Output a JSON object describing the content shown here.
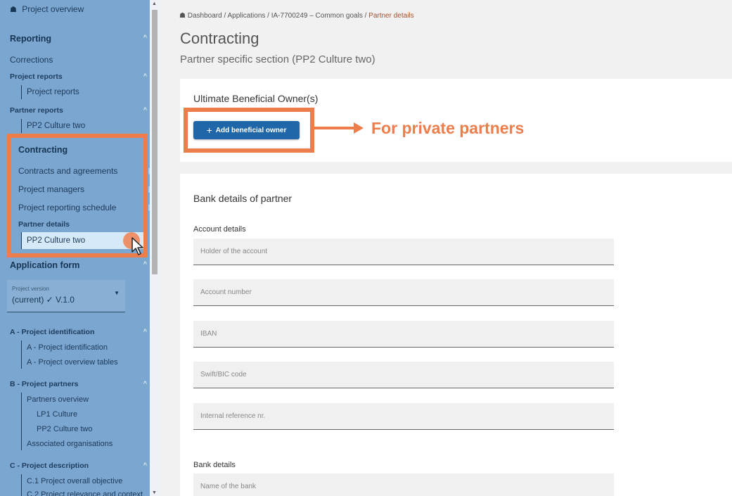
{
  "sidebar": {
    "project_overview": "Project overview",
    "reporting": {
      "title": "Reporting",
      "corrections": "Corrections",
      "project_reports_group": "Project reports",
      "project_reports_item": "Project reports",
      "partner_reports_group": "Partner reports",
      "partner_reports_item": "PP2 Culture two"
    },
    "contracting": {
      "title": "Contracting",
      "contracts": "Contracts and agreements",
      "managers": "Project managers",
      "schedule": "Project reporting schedule",
      "partner_details_group": "Partner details",
      "partner_details_item": "PP2 Culture two"
    },
    "application_form": {
      "title": "Application form",
      "version_label": "Project version",
      "version_value": "(current) ✓ V.1.0"
    },
    "section_a": {
      "title": "A - Project identification",
      "items": [
        "A - Project identification",
        "A - Project overview tables"
      ]
    },
    "section_b": {
      "title": "B - Project partners",
      "items": [
        "Partners overview",
        "LP1 Culture",
        "PP2 Culture two",
        "Associated organisations"
      ]
    },
    "section_c": {
      "title": "C - Project description",
      "items": [
        "C.1 Project overall objective",
        "C.2 Project relevance and context"
      ]
    }
  },
  "breadcrumb": {
    "home": "Dashboard",
    "applications": "Applications",
    "project": "IA-7700249 – Common goals",
    "current": "Partner details"
  },
  "page": {
    "title": "Contracting",
    "subtitle": "Partner specific section (PP2 Culture two)"
  },
  "ubo": {
    "title": "Ultimate Beneficial Owner(s)",
    "add_button": "Add beneficial owner"
  },
  "bank": {
    "title": "Bank details of partner",
    "account_details_label": "Account details",
    "fields": [
      "Holder of the account",
      "Account number",
      "IBAN",
      "Swift/BIC code",
      "Internal reference nr."
    ],
    "bank_details_label": "Bank details",
    "bank_name_field": "Name of the bank"
  },
  "annotation": {
    "text": "For private partners",
    "color": "#ee7d4c"
  }
}
